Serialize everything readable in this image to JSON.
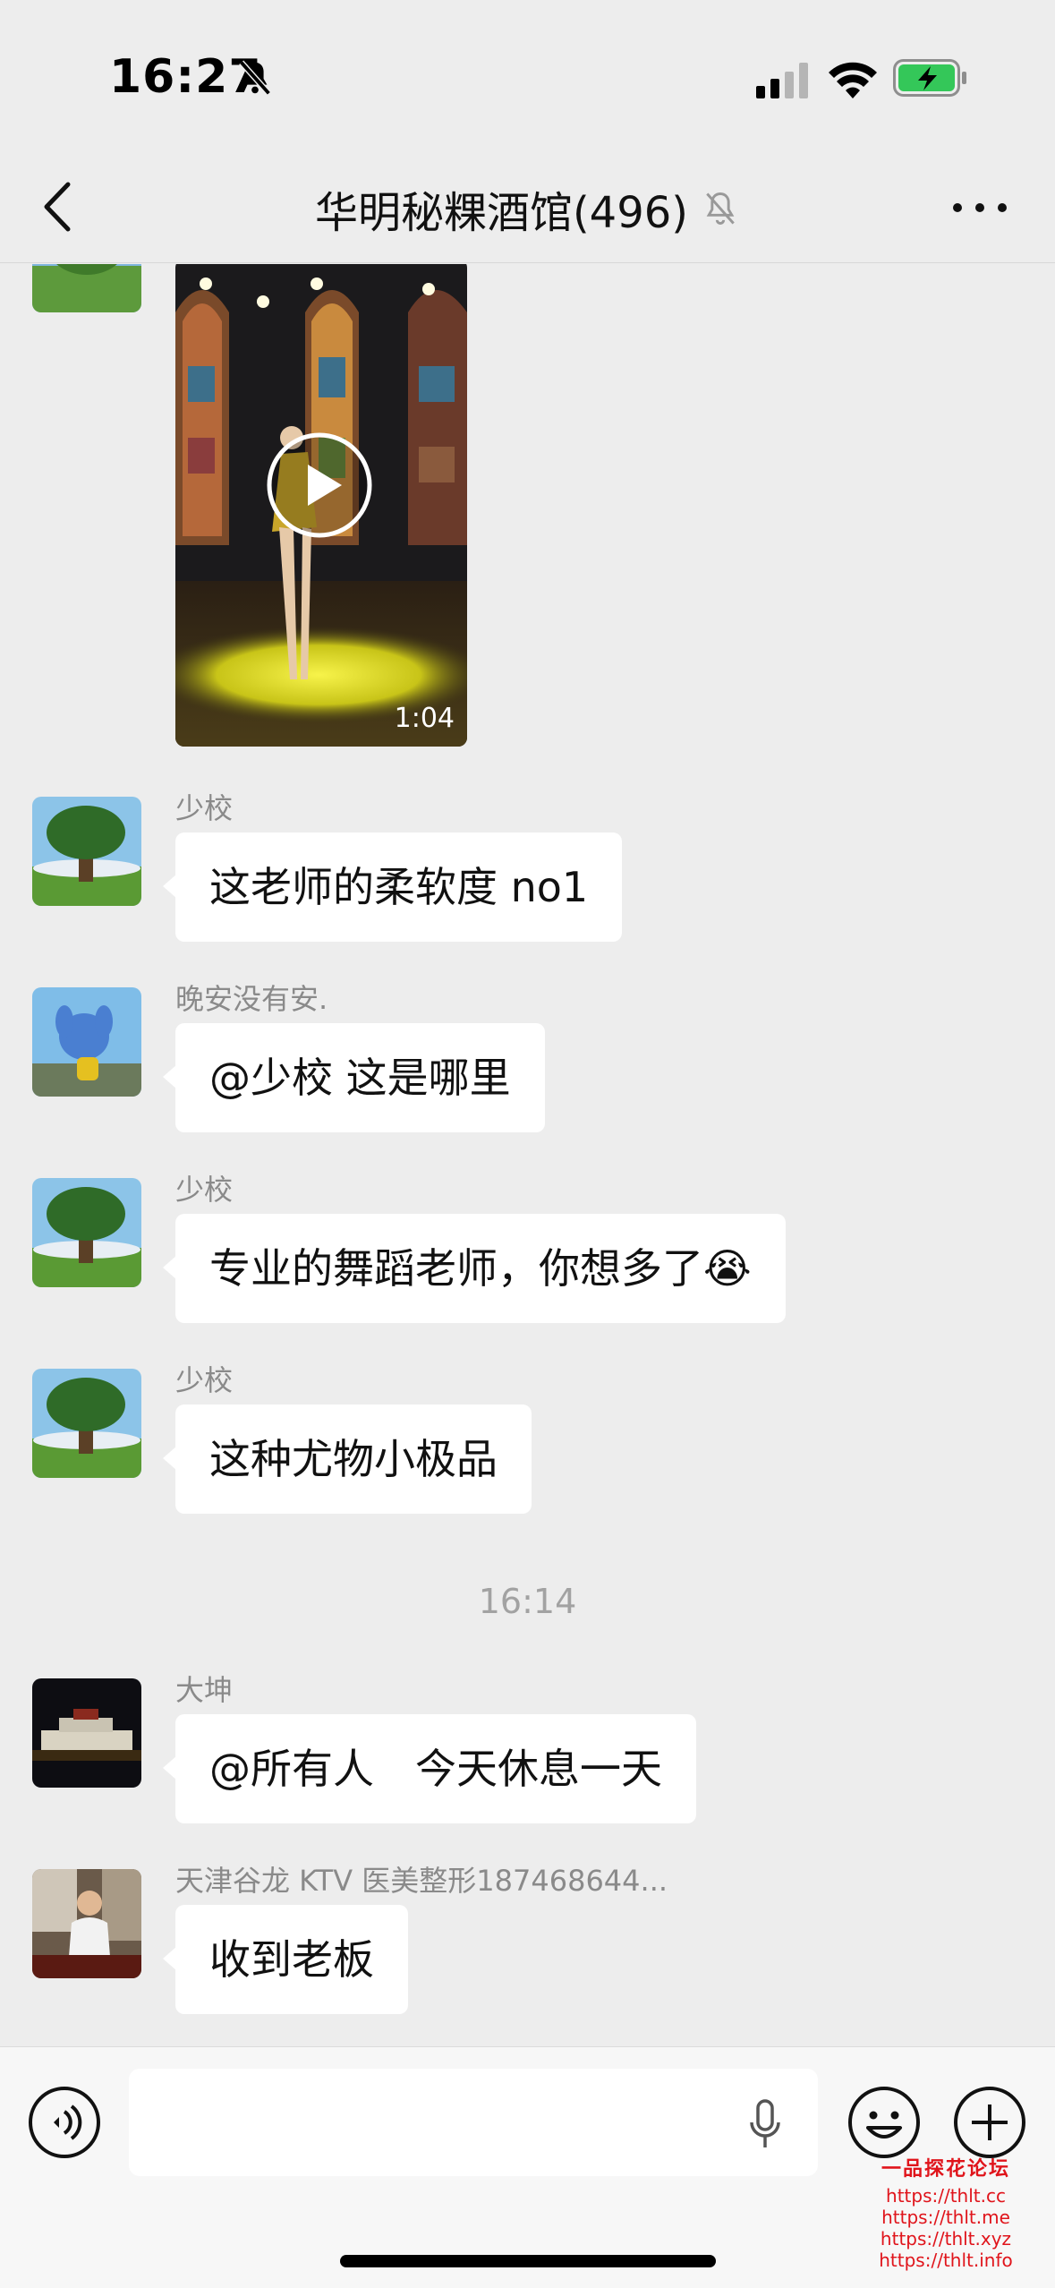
{
  "status_bar": {
    "time": "16:27"
  },
  "header": {
    "back_label": "‹",
    "title": "华明秘粿酒馆(496)"
  },
  "video_message": {
    "duration": "1:04"
  },
  "messages": [
    {
      "sender": "少校",
      "text": "这老师的柔软度 no1",
      "avatar": "tree-landscape"
    },
    {
      "sender": "晚安没有安.",
      "text": "@少校 这是哪里",
      "avatar": "cartoon-character"
    },
    {
      "sender": "少校",
      "text": "专业的舞蹈老师，你想多了",
      "emoji": "😭",
      "avatar": "tree-landscape"
    },
    {
      "sender": "少校",
      "text": "这种尤物小极品",
      "avatar": "tree-landscape"
    }
  ],
  "timestamp": "16:14",
  "messages_after": [
    {
      "sender": "大坤",
      "text": "@所有人　今天休息一天",
      "avatar": "night-palace"
    },
    {
      "sender": "天津谷龙 KTV 医美整形187468644...",
      "text": "收到老板",
      "avatar": "person-photo"
    }
  ],
  "watermark": {
    "title": "一品探花论坛",
    "links": [
      "https://thlt.cc",
      "https://thlt.me",
      "https://thlt.xyz",
      "https://thlt.info"
    ]
  },
  "icons": {
    "bell_off": "bell-off-icon",
    "signal": "signal-icon",
    "wifi": "wifi-icon",
    "battery": "battery-charging-icon",
    "back": "back-chevron-icon",
    "mute": "mute-bell-icon",
    "more": "more-dots-icon",
    "play": "play-icon",
    "voice": "voice-icon",
    "mic": "mic-icon",
    "emoji": "emoji-icon",
    "plus": "plus-icon"
  },
  "colors": {
    "background": "#ededed",
    "bubble": "#ffffff",
    "battery": "#34c759",
    "watermark": "#e0141b"
  }
}
